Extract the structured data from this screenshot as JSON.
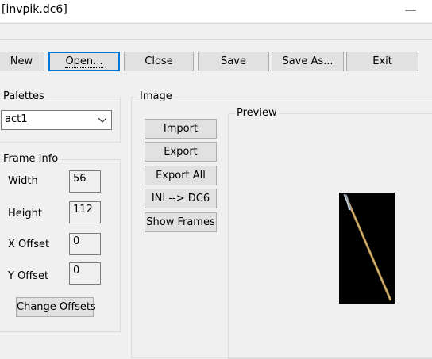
{
  "window": {
    "title": "[invpik.dc6]",
    "minimize_symbol": "—"
  },
  "toolbar": {
    "buttons": [
      {
        "label": "New"
      },
      {
        "label": "Open..."
      },
      {
        "label": "Close"
      },
      {
        "label": "Save"
      },
      {
        "label": "Save As..."
      },
      {
        "label": "Exit"
      }
    ]
  },
  "palettes": {
    "legend": "Palettes",
    "selected": "act1"
  },
  "frame_info": {
    "legend": "Frame Info",
    "width_label": "Width",
    "width_value": "56",
    "height_label": "Height",
    "height_value": "112",
    "xoffset_label": "X Offset",
    "xoffset_value": "0",
    "yoffset_label": "Y Offset",
    "yoffset_value": "0",
    "change_offsets_label": "Change Offsets"
  },
  "image": {
    "legend": "Image",
    "buttons": [
      {
        "label": "Import"
      },
      {
        "label": "Export"
      },
      {
        "label": "Export All"
      },
      {
        "label": "INI --> DC6"
      },
      {
        "label": "Show Frames"
      }
    ]
  },
  "preview": {
    "legend": "Preview",
    "item": "spear"
  }
}
